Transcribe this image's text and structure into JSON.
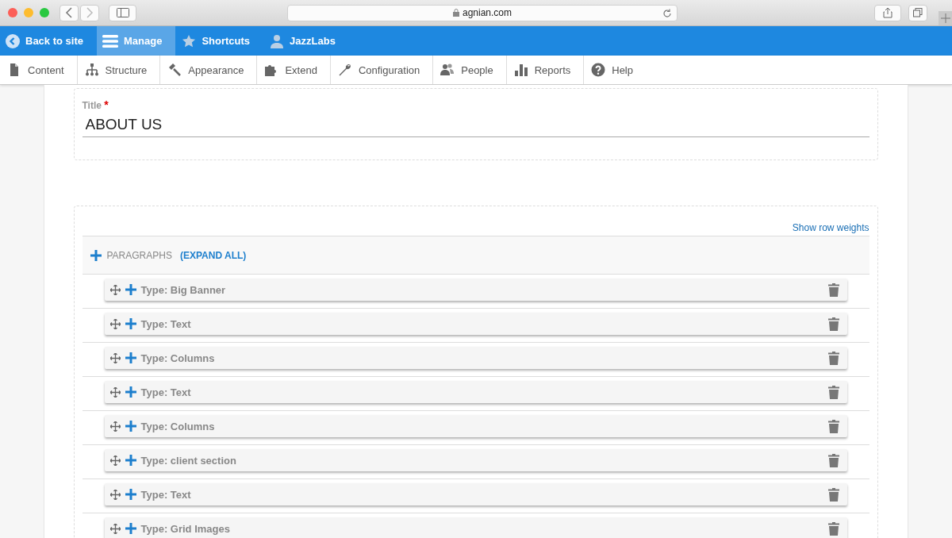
{
  "browser": {
    "address": "agnian.com"
  },
  "toolbar": [
    {
      "label": "Back to site",
      "selected": false
    },
    {
      "label": "Manage",
      "selected": true
    },
    {
      "label": "Shortcuts",
      "selected": false
    },
    {
      "label": "JazzLabs",
      "selected": false
    }
  ],
  "tray": [
    {
      "label": "Content"
    },
    {
      "label": "Structure"
    },
    {
      "label": "Appearance"
    },
    {
      "label": "Extend"
    },
    {
      "label": "Configuration"
    },
    {
      "label": "People"
    },
    {
      "label": "Reports"
    },
    {
      "label": "Help"
    }
  ],
  "title_field": {
    "label": "Title",
    "required_mark": "*",
    "value": "ABOUT US"
  },
  "paragraphs": {
    "show_weights": "Show row weights",
    "heading": "PARAGRAPHS",
    "expand_all": "(EXPAND ALL)",
    "items": [
      {
        "label": "Type: Big Banner"
      },
      {
        "label": "Type: Text"
      },
      {
        "label": "Type: Columns"
      },
      {
        "label": "Type: Text"
      },
      {
        "label": "Type: Columns"
      },
      {
        "label": "Type: client section"
      },
      {
        "label": "Type: Text"
      },
      {
        "label": "Type: Grid Images"
      }
    ]
  }
}
